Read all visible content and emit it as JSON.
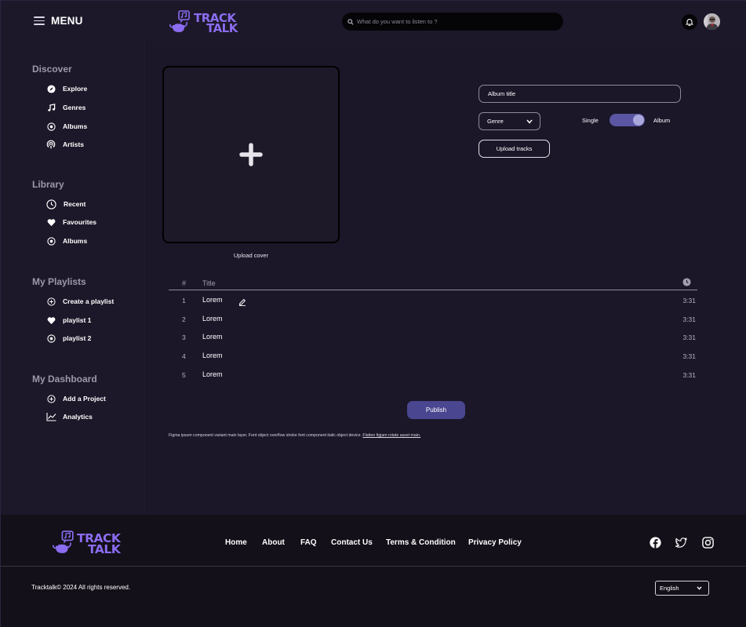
{
  "header": {
    "menu_label": "MENU",
    "logo_line1": "TRACK",
    "logo_line2": "TALK",
    "search_placeholder": "What do you want to listen to ?"
  },
  "sidebar": {
    "discover": {
      "title": "Discover",
      "items": [
        {
          "label": "Explore",
          "icon": "compass-icon"
        },
        {
          "label": "Genres",
          "icon": "music-note-icon"
        },
        {
          "label": "Albums",
          "icon": "disc-icon"
        },
        {
          "label": "Artists",
          "icon": "podcast-icon"
        }
      ]
    },
    "library": {
      "title": "Library",
      "items": [
        {
          "label": "Recent",
          "icon": "clock-icon"
        },
        {
          "label": "Favourites",
          "icon": "heart-icon"
        },
        {
          "label": "Albums",
          "icon": "disc-icon"
        }
      ]
    },
    "playlists": {
      "title": "My Playlists",
      "items": [
        {
          "label": "Create a playlist",
          "icon": "plus-circle-icon"
        },
        {
          "label": "playlist 1",
          "icon": "heart-icon"
        },
        {
          "label": "playlist 2",
          "icon": "disc-icon"
        }
      ]
    },
    "dashboard": {
      "title": "My Dashboard",
      "items": [
        {
          "label": "Add a Project",
          "icon": "plus-circle-icon"
        },
        {
          "label": "Analytics",
          "icon": "line-chart-icon"
        }
      ]
    }
  },
  "main": {
    "upload_cover_label": "Upload cover",
    "album_title_placeholder": "Album title",
    "genre_label": "Genre",
    "toggle_left": "Single",
    "toggle_right": "Album",
    "toggle_state": "Album",
    "upload_tracks_label": "Upload tracks",
    "table": {
      "col_num": "#",
      "col_title": "Title",
      "rows": [
        {
          "num": "1",
          "title": "Lorem",
          "duration": "3:31"
        },
        {
          "num": "2",
          "title": "Lorem",
          "duration": "3:31"
        },
        {
          "num": "3",
          "title": "Lorem",
          "duration": "3:31"
        },
        {
          "num": "4",
          "title": "Lorem",
          "duration": "3:31"
        },
        {
          "num": "5",
          "title": "Lorem",
          "duration": "3:31"
        }
      ]
    },
    "publish_label": "Publish",
    "note_text": "Figma ipsum component variant main layer. Font object overflow stroke font component italic object device.",
    "note_link": "Flatten figjam rotate asset main."
  },
  "footer": {
    "nav": [
      "Home",
      "About",
      "FAQ",
      "Contact Us",
      "Terms & Condition",
      "Privacy Policy"
    ],
    "social_icons": [
      "facebook-icon",
      "twitter-icon",
      "instagram-icon"
    ],
    "copyright": "Tracktalk© 2024 All rights reserved.",
    "language": "English"
  },
  "colors": {
    "background": "#1b1729",
    "footer": "#131019",
    "brand": "#8b6cf0",
    "toggle_track": "#5a56a3",
    "publish_button": "#4a4690"
  }
}
